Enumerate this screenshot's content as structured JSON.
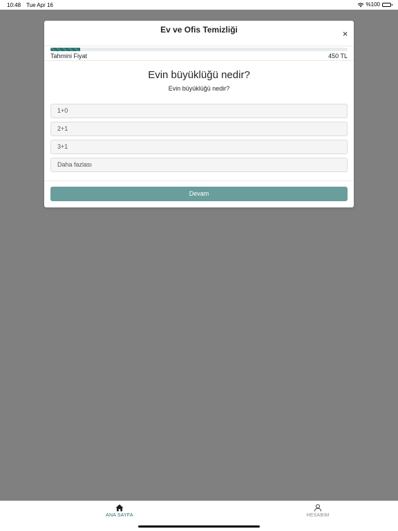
{
  "status_bar": {
    "time": "10:48",
    "date": "Tue Apr 16",
    "battery_text": "%100",
    "icons": [
      "wifi-icon",
      "battery-icon"
    ]
  },
  "modal": {
    "title": "Ev ve Ofis Temizliği",
    "close_label": "×",
    "progress_fraction": 0.1,
    "price_label": "Tahmini Fiyat",
    "price_value": "450 TL",
    "question_title": "Evin büyüklüğü nedir?",
    "question_subtitle": "Evin büyüklüğü nedir?",
    "options": [
      {
        "label": "1+0"
      },
      {
        "label": "2+1"
      },
      {
        "label": "3+1"
      },
      {
        "label": "Daha fazlası"
      }
    ],
    "continue_label": "Devam"
  },
  "tab_bar": {
    "tabs": [
      {
        "label": "ANA SAYFA",
        "icon": "home-icon",
        "active": true
      },
      {
        "label": "HESABIM",
        "icon": "user-icon",
        "active": false
      }
    ]
  },
  "colors": {
    "accent": "#2e6e6c",
    "button": "#6a9e9c",
    "backdrop": "#808080"
  }
}
